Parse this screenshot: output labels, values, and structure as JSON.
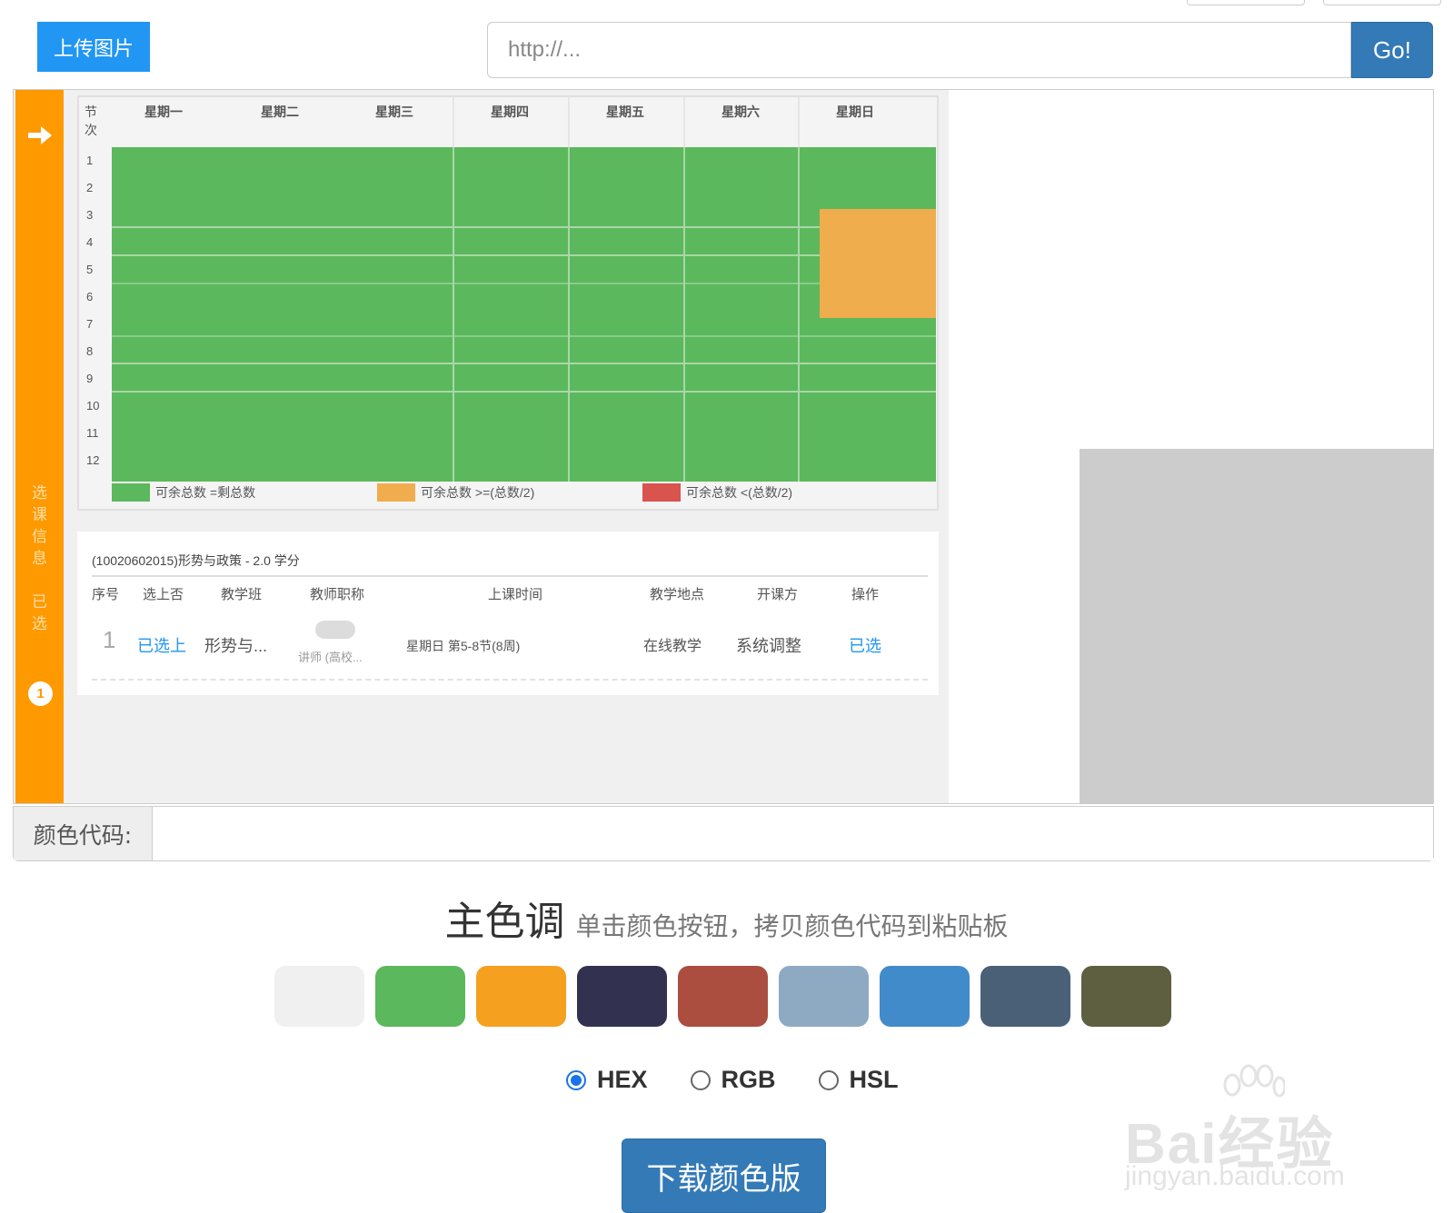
{
  "toolbar": {
    "upload_label": "上传图片",
    "url_placeholder": "http://...",
    "go_label": "Go!"
  },
  "screenshot": {
    "sidebar_label_1": "选课信息",
    "sidebar_label_2": "已选",
    "sidebar_badge": "1",
    "timetable": {
      "corner": "节次",
      "days": [
        "星期一",
        "星期二",
        "星期三",
        "星期四",
        "星期五",
        "星期六",
        "星期日"
      ],
      "periods": [
        "1",
        "2",
        "3",
        "4",
        "5",
        "6",
        "7",
        "8",
        "9",
        "10",
        "11",
        "12"
      ],
      "legend": [
        {
          "label": "可余总数 =剩总数",
          "color": "#5cb85c"
        },
        {
          "label": "可余总数 >=(总数/2)",
          "color": "#f0ad4e"
        },
        {
          "label": "可余总数 <(总数/2)",
          "color": "#d9534f"
        }
      ]
    },
    "detail": {
      "title": "(10020602015)形势与政策 - 2.0 学分",
      "headers": [
        "序号",
        "选上否",
        "教学班",
        "教师职称",
        "上课时间",
        "教学地点",
        "开课方",
        "操作"
      ],
      "row": {
        "seq": "1",
        "selected": "已选上",
        "class": "形势与...",
        "teacher_sub": "讲师 (高校...",
        "time": "星期日 第5-8节(8周)",
        "place": "在线教学",
        "dept": "系统调整",
        "action": "已选"
      }
    }
  },
  "color_code": {
    "label": "颜色代码:",
    "value": ""
  },
  "heading": {
    "main": "主色调",
    "sub": "单击颜色按钮，拷贝颜色代码到粘贴板"
  },
  "palette": [
    "#f0f0f0",
    "#5cb85c",
    "#f5a01f",
    "#323250",
    "#ab4e40",
    "#8eaac3",
    "#428bca",
    "#4a6077",
    "#5e5e40"
  ],
  "formats": [
    {
      "label": "HEX",
      "checked": true
    },
    {
      "label": "RGB",
      "checked": false
    },
    {
      "label": "HSL",
      "checked": false
    }
  ],
  "download_label": "下载颜色版",
  "watermark": {
    "main": "Bai经验",
    "sub": "jingyan.baidu.com"
  }
}
